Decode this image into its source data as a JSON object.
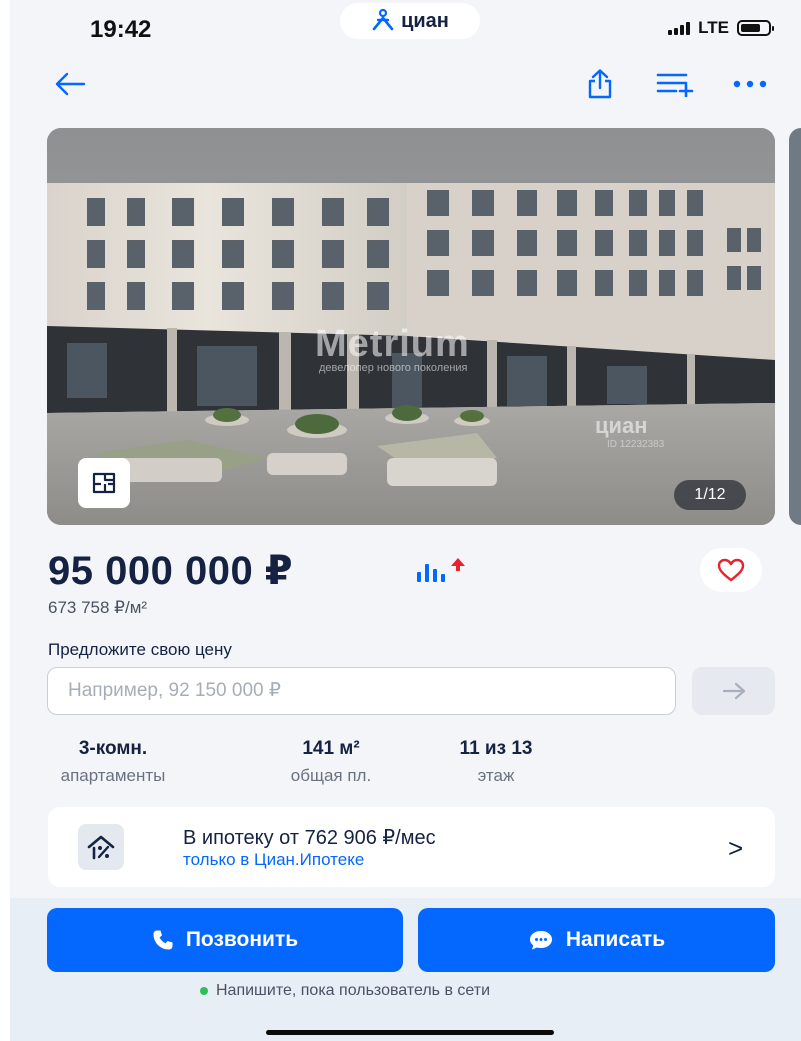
{
  "status": {
    "time": "19:42",
    "site": "циан",
    "network": "LTE",
    "battery_level": 0.72
  },
  "gallery": {
    "counter": "1/12",
    "watermark": "Metrium",
    "watermark_sub": "девелопер нового поколения",
    "watermark2": "циан",
    "watermark2_sub": "ID 12232383"
  },
  "listing": {
    "price": "95 000 000 ₽",
    "price_per_m": "673 758 ₽/м²",
    "offer_label": "Предложите свою цену",
    "offer_placeholder": "Например, 92 150 000 ₽",
    "facts": [
      {
        "value": "3-комн.",
        "label": "апартаменты"
      },
      {
        "value": "141 м²",
        "label": "общая пл."
      },
      {
        "value": "11 из 13",
        "label": "этаж"
      }
    ]
  },
  "mortgage": {
    "title": "В ипотеку от 762 906 ₽/мес",
    "subtitle": "только в Циан.Ипотеке",
    "chevron": ">"
  },
  "actions": {
    "call_label": "Позвонить",
    "write_label": "Написать",
    "online_note": "Напишите, пока пользователь в сети"
  },
  "colors": {
    "accent": "#0468ff",
    "text": "#152242",
    "online": "#2fbf5a",
    "price_up": "#e8232f",
    "heart": "#e8232f"
  }
}
